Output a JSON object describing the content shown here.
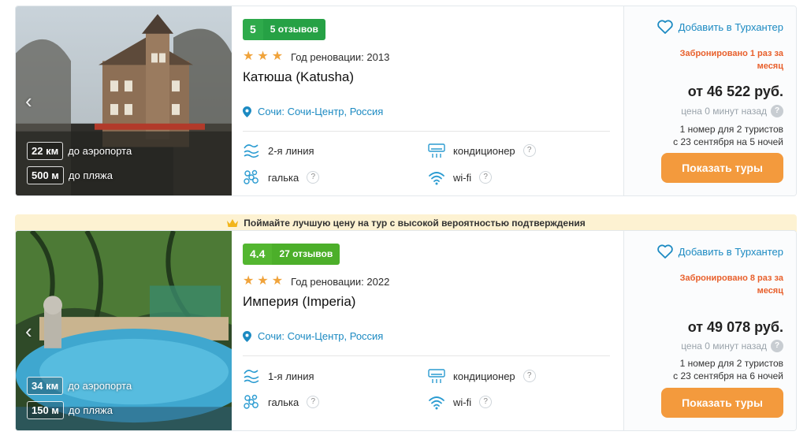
{
  "banner": {
    "icon": "crown-icon",
    "text": "Поймайте лучшую цену на тур с высокой вероятностью подтверждения"
  },
  "hotels": [
    {
      "rating": "5",
      "reviews": "5 отзывов",
      "stars": 3,
      "renovation": "Год реновации: 2013",
      "name": "Катюша (Katusha)",
      "location": "Сочи: Сочи-Центр, Россия",
      "dist_airport_val": "22 км",
      "dist_airport_lbl": "до аэропорта",
      "dist_beach_val": "500 м",
      "dist_beach_lbl": "до пляжа",
      "features": {
        "line": "2-я линия",
        "ac": "кондиционер",
        "beach": "галька",
        "wifi": "wi-fi",
        "q": "?"
      },
      "favorite": "Добавить в Турхантер",
      "booked": "Забронировано 1 раз за месяц",
      "price": "от 46 522 руб.",
      "updated": "цена 0 минут назад",
      "tour_line1": "1 номер для 2 туристов",
      "tour_line2": "с 23 сентября на 5 ночей",
      "button": "Показать туры"
    },
    {
      "rating": "4.4",
      "reviews": "27 отзывов",
      "stars": 3,
      "renovation": "Год реновации: 2022",
      "name": "Империя (Imperia)",
      "location": "Сочи: Сочи-Центр, Россия",
      "dist_airport_val": "34 км",
      "dist_airport_lbl": "до аэропорта",
      "dist_beach_val": "150 м",
      "dist_beach_lbl": "до пляжа",
      "features": {
        "line": "1-я линия",
        "ac": "кондиционер",
        "beach": "галька",
        "wifi": "wi-fi",
        "q": "?"
      },
      "favorite": "Добавить в Турхантер",
      "booked": "Забронировано 8 раз за месяц",
      "price": "от 49 078 руб.",
      "updated": "цена 0 минут назад",
      "tour_line1": "1 номер для 2 туристов",
      "tour_line2": "с 23 сентября на 6 ночей",
      "button": "Показать туры"
    }
  ],
  "icons": {
    "location": "location-pin-icon",
    "heart": "heart-icon",
    "wave": "sea-line-icon",
    "ac": "air-conditioner-icon",
    "pebble": "pebble-beach-icon",
    "wifi": "wifi-icon",
    "arrow_left": "‹",
    "arrow_right": "›",
    "star": "★"
  },
  "colors": {
    "link": "#1c8ac2",
    "accent_orange": "#f39a3d",
    "booked": "#e8602c",
    "rating_green": "#2eaa4b"
  }
}
